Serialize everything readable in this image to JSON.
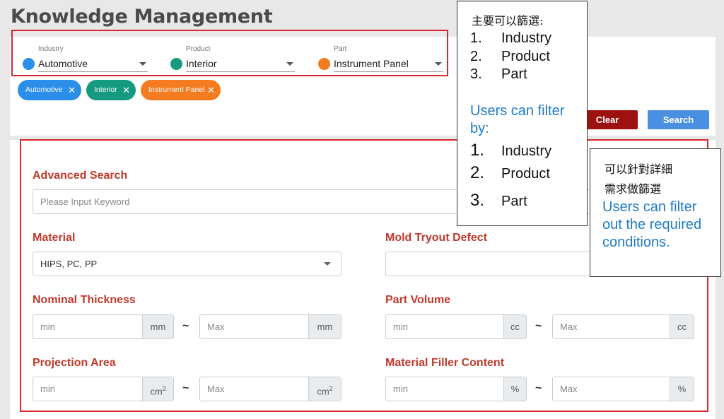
{
  "page": {
    "title": "Knowledge Management"
  },
  "filters": {
    "industry": {
      "caption": "Industry",
      "value": "Automotive",
      "color": "#2b8ee8"
    },
    "product": {
      "caption": "Product",
      "value": "Interior",
      "color": "#159a80"
    },
    "part": {
      "caption": "Part",
      "value": "Instrument Panel",
      "color": "#f47b20"
    }
  },
  "chips": [
    {
      "label": "Automotive",
      "color": "#2b8ee8",
      "close": "✕"
    },
    {
      "label": "Interior",
      "color": "#159a80",
      "close": "✕"
    },
    {
      "label": "Instrument Panel",
      "color": "#f47b20",
      "close": "✕"
    }
  ],
  "buttons": {
    "clear": {
      "label": "Clear",
      "color": "#9e1111"
    },
    "search": {
      "label": "Search",
      "color": "#4a90e2"
    }
  },
  "advanced": {
    "heading": "Advanced Search",
    "keyword_placeholder": "Please Input Keyword",
    "material": {
      "label": "Material",
      "value": "HIPS, PC, PP"
    },
    "mold_defect": {
      "label": "Mold Tryout Defect",
      "value": ""
    },
    "nominal_thickness": {
      "label": "Nominal Thickness",
      "min": "min",
      "max": "Max",
      "unit": "mm",
      "sep": "~"
    },
    "part_volume": {
      "label": "Part Volume",
      "min": "min",
      "max": "Max",
      "unit": "cc",
      "sep": "~"
    },
    "projection_area": {
      "label": "Projection Area",
      "min": "min",
      "max": "Max",
      "unit": "cm",
      "unit_sup": "2",
      "sep": "~"
    },
    "filler_content": {
      "label": "Material Filler Content",
      "min": "min",
      "max": "Max",
      "unit": "%",
      "sep": "~"
    }
  },
  "callout_top": {
    "zh": "主要可以篩選:",
    "items": [
      "Industry",
      "Product",
      "Part"
    ],
    "nums": [
      "1.",
      "2.",
      "3."
    ],
    "en": "Users can filter by:",
    "items2": [
      "Industry",
      "Product",
      "Part"
    ],
    "nums2": [
      "1.",
      "2.",
      "3."
    ]
  },
  "callout_right": {
    "zh_line1": "可以針對詳細",
    "zh_line2": "需求做篩選",
    "en": "Users can filter out the required conditions."
  }
}
